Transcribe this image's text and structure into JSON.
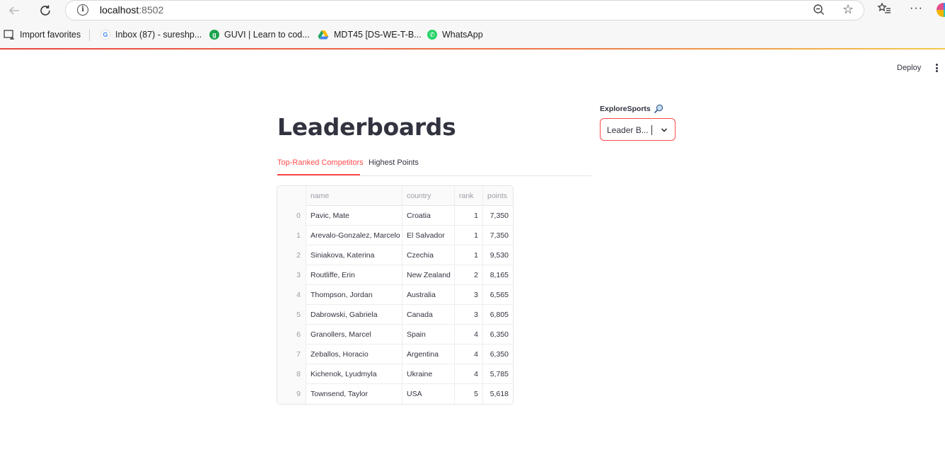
{
  "browser": {
    "url_host": "localhost",
    "url_port": ":8502",
    "bookmarks": [
      {
        "label": "Import favorites",
        "icon": "import-icon"
      },
      {
        "label": "Inbox (87) - sureshp...",
        "icon": "google-icon"
      },
      {
        "label": "GUVI | Learn to cod...",
        "icon": "guvi-icon"
      },
      {
        "label": "MDT45 [DS-WE-T-B...",
        "icon": "drive-icon"
      },
      {
        "label": "WhatsApp",
        "icon": "whatsapp-icon"
      }
    ]
  },
  "app_header": {
    "deploy_label": "Deploy"
  },
  "main": {
    "title": "Leaderboards",
    "tabs": [
      {
        "label": "Top-Ranked Competitors",
        "active": true
      },
      {
        "label": "Highest Points",
        "active": false
      }
    ]
  },
  "table": {
    "columns": [
      "",
      "name",
      "country",
      "rank",
      "points"
    ],
    "rows": [
      {
        "idx": "0",
        "name": "Pavic, Mate",
        "country": "Croatia",
        "rank": "1",
        "points": "7,350"
      },
      {
        "idx": "1",
        "name": "Arevalo-Gonzalez, Marcelo",
        "country": "El Salvador",
        "rank": "1",
        "points": "7,350"
      },
      {
        "idx": "2",
        "name": "Siniakova, Katerina",
        "country": "Czechia",
        "rank": "1",
        "points": "9,530"
      },
      {
        "idx": "3",
        "name": "Routliffe, Erin",
        "country": "New Zealand",
        "rank": "2",
        "points": "8,165"
      },
      {
        "idx": "4",
        "name": "Thompson, Jordan",
        "country": "Australia",
        "rank": "3",
        "points": "6,565"
      },
      {
        "idx": "5",
        "name": "Dabrowski, Gabriela",
        "country": "Canada",
        "rank": "3",
        "points": "6,805"
      },
      {
        "idx": "6",
        "name": "Granollers, Marcel",
        "country": "Spain",
        "rank": "4",
        "points": "6,350"
      },
      {
        "idx": "7",
        "name": "Zeballos, Horacio",
        "country": "Argentina",
        "rank": "4",
        "points": "6,350"
      },
      {
        "idx": "8",
        "name": "Kichenok, Lyudmyla",
        "country": "Ukraine",
        "rank": "4",
        "points": "5,785"
      },
      {
        "idx": "9",
        "name": "Townsend, Taylor",
        "country": "USA",
        "rank": "5",
        "points": "5,618"
      }
    ]
  },
  "sidebar_select": {
    "label": "ExploreSports",
    "label_icon": "tennis-racket-icon",
    "value": "Leader B..."
  },
  "colors": {
    "accent": "#ff4b4b",
    "text": "#31333f",
    "muted": "#9a9ca4"
  }
}
